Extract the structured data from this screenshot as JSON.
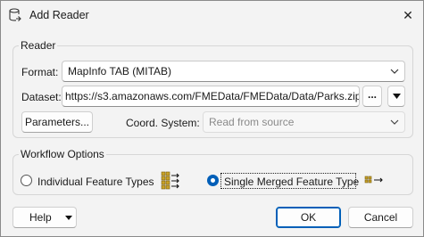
{
  "window": {
    "title": "Add Reader",
    "close_glyph": "✕"
  },
  "reader": {
    "group_label": "Reader",
    "format_label": "Format:",
    "format_value": "MapInfo TAB (MITAB)",
    "dataset_label": "Dataset:",
    "dataset_value": "https://s3.amazonaws.com/FMEData/FMEData/Data/Parks.zip",
    "browse_label": "...",
    "parameters_label": "Parameters...",
    "coord_label": "Coord. System:",
    "coord_value": "Read from source"
  },
  "workflow": {
    "group_label": "Workflow Options",
    "option_individual": "Individual Feature Types",
    "option_merged": "Single Merged Feature Type",
    "selected": "merged"
  },
  "footer": {
    "help_label": "Help",
    "ok_label": "OK",
    "cancel_label": "Cancel"
  },
  "colors": {
    "accent": "#005fb8",
    "icon_table": "#c9a227"
  },
  "icons": {
    "app": "add-reader-icon",
    "individual": "multi-table-arrows-icon",
    "merged": "single-table-arrow-icon"
  }
}
